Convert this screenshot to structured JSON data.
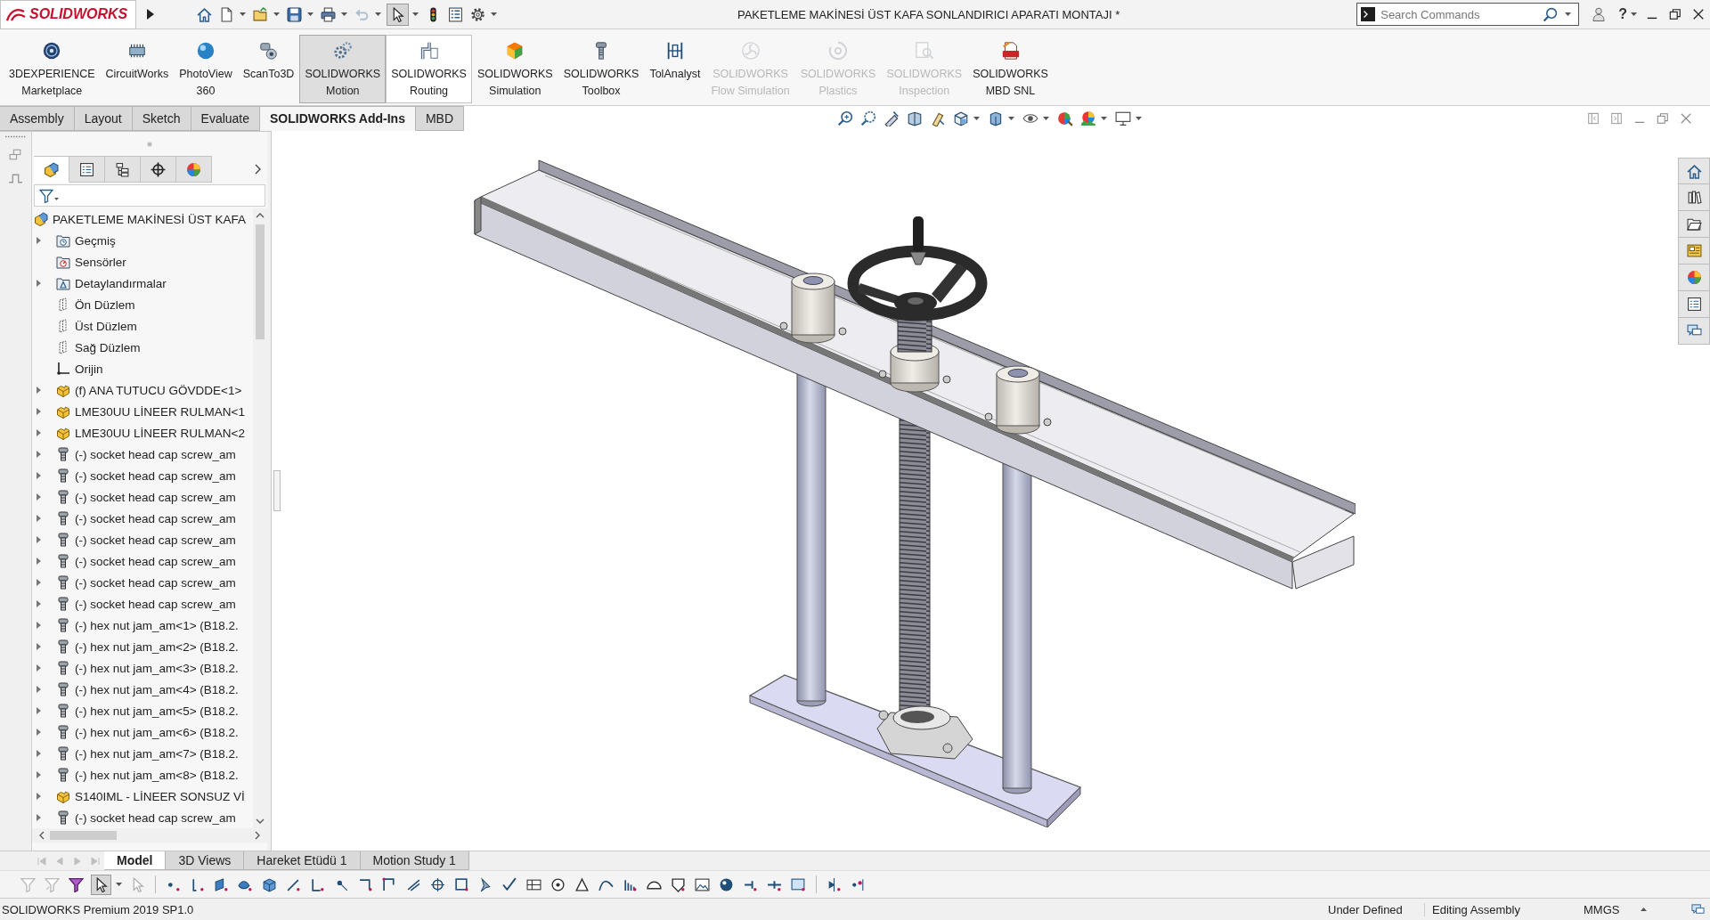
{
  "title_bar": {
    "logo": "SOLIDWORKS",
    "title": "PAKETLEME MAKİNESİ ÜST KAFA SONLANDIRICI APARATI MONTAJI *",
    "search": {
      "placeholder": "Search Commands"
    },
    "help": "?"
  },
  "quick_access": {
    "undo_enabled": false,
    "select_pressed": true
  },
  "command_manager": [
    {
      "lines": [
        "3DEXPERIENCE",
        "Marketplace"
      ],
      "pressed": false,
      "highlighted": false,
      "disabled": false
    },
    {
      "lines": [
        "CircuitWorks"
      ],
      "pressed": false,
      "highlighted": false,
      "disabled": false
    },
    {
      "lines": [
        "PhotoView",
        "360"
      ],
      "pressed": false,
      "highlighted": false,
      "disabled": false
    },
    {
      "lines": [
        "ScanTo3D"
      ],
      "pressed": false,
      "highlighted": false,
      "disabled": false
    },
    {
      "lines": [
        "SOLIDWORKS",
        "Motion"
      ],
      "pressed": true,
      "highlighted": false,
      "disabled": false
    },
    {
      "lines": [
        "SOLIDWORKS",
        "Routing"
      ],
      "pressed": false,
      "highlighted": true,
      "disabled": false
    },
    {
      "lines": [
        "SOLIDWORKS",
        "Simulation"
      ],
      "pressed": false,
      "highlighted": false,
      "disabled": false
    },
    {
      "lines": [
        "SOLIDWORKS",
        "Toolbox"
      ],
      "pressed": false,
      "highlighted": false,
      "disabled": false
    },
    {
      "lines": [
        "TolAnalyst"
      ],
      "pressed": false,
      "highlighted": false,
      "disabled": false
    },
    {
      "lines": [
        "SOLIDWORKS",
        "Flow Simulation"
      ],
      "pressed": false,
      "highlighted": false,
      "disabled": true
    },
    {
      "lines": [
        "SOLIDWORKS",
        "Plastics"
      ],
      "pressed": false,
      "highlighted": false,
      "disabled": true
    },
    {
      "lines": [
        "SOLIDWORKS",
        "Inspection"
      ],
      "pressed": false,
      "highlighted": false,
      "disabled": true
    },
    {
      "lines": [
        "SOLIDWORKS",
        "MBD SNL"
      ],
      "pressed": false,
      "highlighted": false,
      "disabled": false
    }
  ],
  "tabs": [
    {
      "label": "Assembly",
      "selected": false
    },
    {
      "label": "Layout",
      "selected": false
    },
    {
      "label": "Sketch",
      "selected": false
    },
    {
      "label": "Evaluate",
      "selected": false
    },
    {
      "label": "SOLIDWORKS Add-Ins",
      "selected": true
    },
    {
      "label": "MBD",
      "selected": false
    }
  ],
  "feature_manager_tabs": [
    {
      "selected": true
    },
    {
      "selected": false
    },
    {
      "selected": false
    },
    {
      "selected": false
    },
    {
      "selected": false
    }
  ],
  "feature_tree": {
    "root": {
      "label": "PAKETLEME MAKİNESİ ÜST KAFA",
      "kind": "assembly",
      "children": [
        {
          "label": "Geçmiş",
          "kind": "history",
          "expandable": true
        },
        {
          "label": "Sensörler",
          "kind": "sensors",
          "expandable": false
        },
        {
          "label": "Detaylandırmalar",
          "kind": "annotations",
          "expandable": true
        },
        {
          "label": "Ön Düzlem",
          "kind": "plane",
          "expandable": false
        },
        {
          "label": "Üst Düzlem",
          "kind": "plane",
          "expandable": false
        },
        {
          "label": "Sağ Düzlem",
          "kind": "plane",
          "expandable": false
        },
        {
          "label": "Orijin",
          "kind": "origin",
          "expandable": false
        },
        {
          "label": "(f) ANA TUTUCU GÖVDDE<1>",
          "kind": "part",
          "expandable": true
        },
        {
          "label": "LME30UU LİNEER RULMAN<1",
          "kind": "part",
          "expandable": true
        },
        {
          "label": "LME30UU LİNEER RULMAN<2",
          "kind": "part",
          "expandable": true
        },
        {
          "label": "(-) socket head cap screw_am",
          "kind": "fastener",
          "expandable": true
        },
        {
          "label": "(-) socket head cap screw_am",
          "kind": "fastener",
          "expandable": true
        },
        {
          "label": "(-) socket head cap screw_am",
          "kind": "fastener",
          "expandable": true
        },
        {
          "label": "(-) socket head cap screw_am",
          "kind": "fastener",
          "expandable": true
        },
        {
          "label": "(-) socket head cap screw_am",
          "kind": "fastener",
          "expandable": true
        },
        {
          "label": "(-) socket head cap screw_am",
          "kind": "fastener",
          "expandable": true
        },
        {
          "label": "(-) socket head cap screw_am",
          "kind": "fastener",
          "expandable": true
        },
        {
          "label": "(-) socket head cap screw_am",
          "kind": "fastener",
          "expandable": true
        },
        {
          "label": "(-) hex nut jam_am<1> (B18.2.",
          "kind": "fastener",
          "expandable": true
        },
        {
          "label": "(-) hex nut jam_am<2> (B18.2.",
          "kind": "fastener",
          "expandable": true
        },
        {
          "label": "(-) hex nut jam_am<3> (B18.2.",
          "kind": "fastener",
          "expandable": true
        },
        {
          "label": "(-) hex nut jam_am<4> (B18.2.",
          "kind": "fastener",
          "expandable": true
        },
        {
          "label": "(-) hex nut jam_am<5> (B18.2.",
          "kind": "fastener",
          "expandable": true
        },
        {
          "label": "(-) hex nut jam_am<6> (B18.2.",
          "kind": "fastener",
          "expandable": true
        },
        {
          "label": "(-) hex nut jam_am<7> (B18.2.",
          "kind": "fastener",
          "expandable": true
        },
        {
          "label": "(-) hex nut jam_am<8> (B18.2.",
          "kind": "fastener",
          "expandable": true
        },
        {
          "label": "S140IML - LİNEER SONSUZ Vİ",
          "kind": "part",
          "expandable": true
        },
        {
          "label": "(-) socket head cap screw_am",
          "kind": "fastener",
          "expandable": true
        }
      ]
    }
  },
  "bottom_tabs": {
    "nav_enabled": false,
    "tabs": [
      {
        "label": "Model",
        "selected": true
      },
      {
        "label": "3D Views",
        "selected": false
      },
      {
        "label": "Hareket Etüdü 1",
        "selected": false
      },
      {
        "label": "Motion Study 1",
        "selected": false
      }
    ]
  },
  "selection_toolbar": {
    "select_pressed": true
  },
  "status_bar": {
    "product": "SOLIDWORKS Premium 2019 SP1.0",
    "fields": [
      "Under Defined",
      "Editing Assembly",
      "MMGS"
    ]
  }
}
